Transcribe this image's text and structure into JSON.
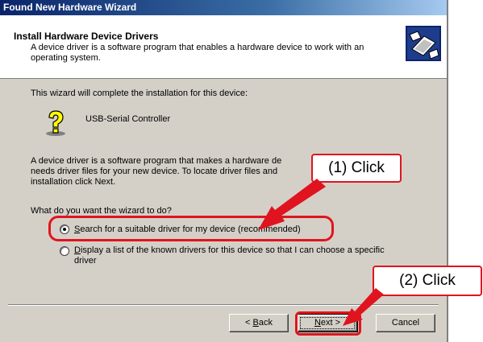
{
  "window": {
    "title": "Found New Hardware Wizard"
  },
  "header": {
    "title": "Install Hardware Device Drivers",
    "subtitle": "A device driver is a software program that enables a hardware device to work with an operating system.",
    "icon": "hardware-wizard-icon"
  },
  "body": {
    "intro": "This wizard will complete the installation for this device:",
    "device_name": "USB-Serial Controller",
    "device_icon": "unknown-device-question-icon",
    "paragraph_line1": "A device driver is a software program that makes a hardware de",
    "paragraph_line2": "needs driver files for your new device. To locate driver files and",
    "paragraph_line3": "installation click Next.",
    "question": "What do you want the wizard to do?",
    "options": [
      {
        "label_accel": "S",
        "label_rest": "earch for a suitable driver for my device (recommended)",
        "selected": true
      },
      {
        "label_accel": "D",
        "label_rest": "isplay a list of the known drivers for this device so that I can choose a specific",
        "label_line2": "driver",
        "selected": false
      }
    ]
  },
  "buttons": {
    "back_prefix": "< ",
    "back_accel": "B",
    "back_rest": "ack",
    "next_accel": "N",
    "next_rest": "ext >",
    "cancel": "Cancel"
  },
  "annotations": {
    "callout1": "(1) Click",
    "callout2": "(2) Click",
    "color": "#e0141e"
  }
}
